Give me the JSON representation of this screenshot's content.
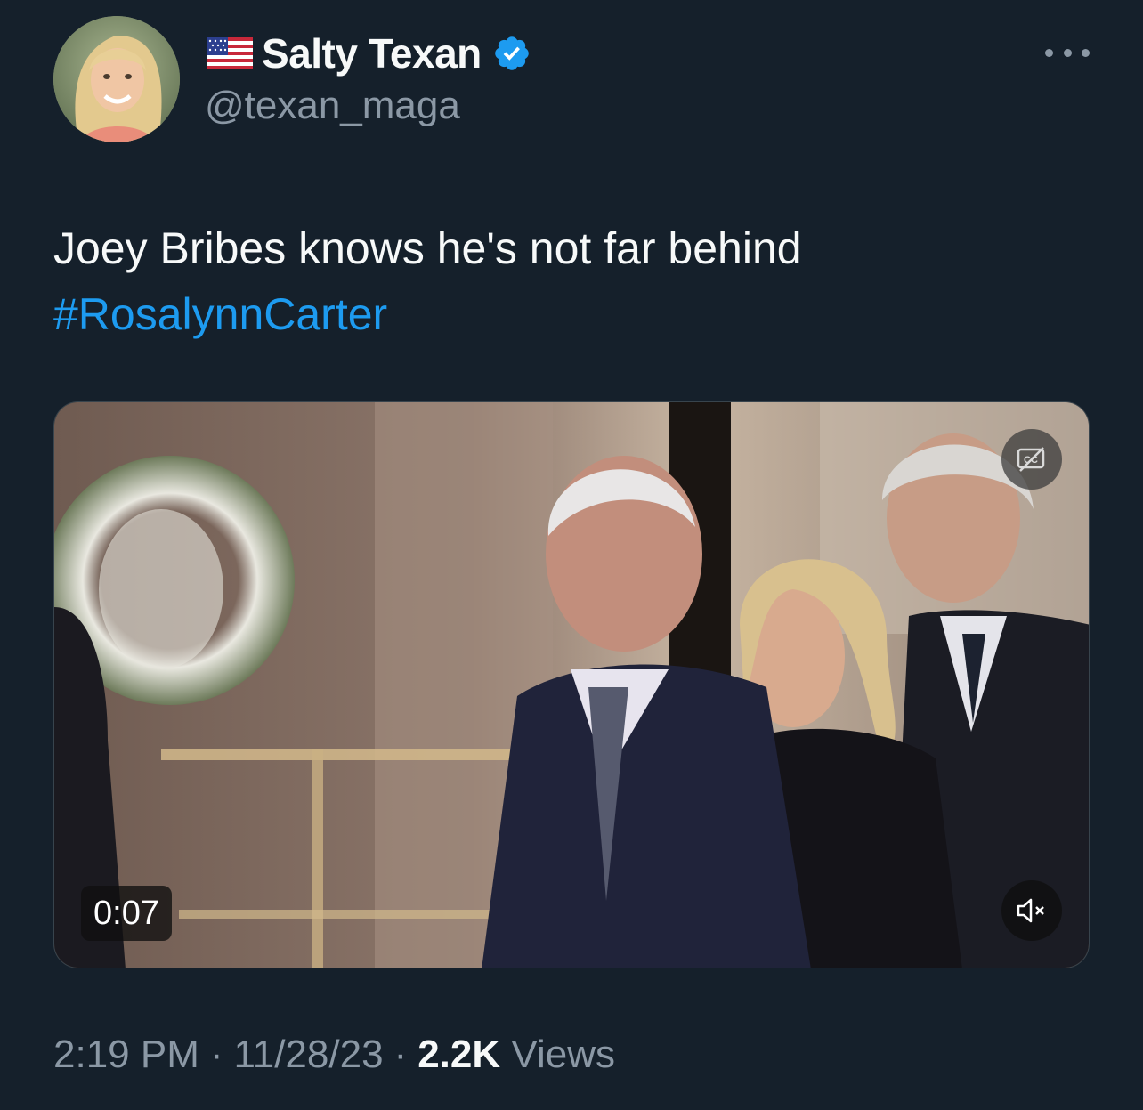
{
  "author": {
    "display_name": "Salty Texan",
    "handle": "@texan_maga",
    "flag_icon": "us-flag-icon",
    "verified_icon": "verified-badge-icon",
    "verified_color": "#1d9bf0"
  },
  "tweet": {
    "text": "Joey Bribes knows he's not far behind",
    "hashtag": "#RosalynnCarter",
    "hashtag_color": "#1d9bf0"
  },
  "media": {
    "type": "video",
    "duration": "0:07",
    "captions_icon": "closed-captions-icon",
    "mute_icon": "muted-speaker-icon"
  },
  "meta": {
    "time": "2:19 PM",
    "separator": "·",
    "date": "11/28/23",
    "views_count": "2.2K",
    "views_label": "Views"
  },
  "menu": {
    "more_icon": "more-options-icon"
  },
  "colors": {
    "background": "#15202b",
    "primary_text": "#f7f9f9",
    "secondary_text": "#8b98a5",
    "accent": "#1d9bf0"
  }
}
